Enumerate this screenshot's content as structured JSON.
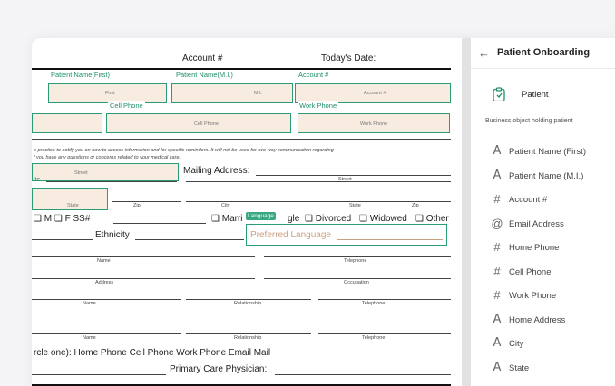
{
  "sidebar": {
    "back_icon": "arrow-left-icon",
    "title": "Patient Onboarding",
    "object_name": "Patient",
    "object_description": "Business object holding patient",
    "fields": [
      {
        "icon": "text-icon",
        "glyph": "A",
        "label": "Patient Name (First)"
      },
      {
        "icon": "text-icon",
        "glyph": "A",
        "label": "Patient Name (M.I.)"
      },
      {
        "icon": "number-icon",
        "glyph": "#",
        "label": "Account #"
      },
      {
        "icon": "email-icon",
        "glyph": "@",
        "label": "Email Address"
      },
      {
        "icon": "number-icon",
        "glyph": "#",
        "label": "Home Phone"
      },
      {
        "icon": "number-icon",
        "glyph": "#",
        "label": "Cell Phone"
      },
      {
        "icon": "number-icon",
        "glyph": "#",
        "label": "Work Phone"
      },
      {
        "icon": "text-icon",
        "glyph": "A",
        "label": "Home Address"
      },
      {
        "icon": "text-icon",
        "glyph": "A",
        "label": "City"
      },
      {
        "icon": "text-icon",
        "glyph": "A",
        "label": "State"
      }
    ]
  },
  "doc": {
    "account_label": "Account #",
    "today_label": "Today's Date:",
    "overlays": {
      "first_label": "Patient Name(First)",
      "first_inner": "First",
      "mi_label": "Patient Name(M.I.)",
      "mi_inner": "M.I.",
      "account_label": "Account #",
      "account_inner": "Account #",
      "cell_label": "Cell Phone",
      "cell_inner": "Cell Phone",
      "work_label": "Work Phone",
      "work_inner": "Work Phone",
      "street_label": "Street",
      "state_inner": "State",
      "language_tag": "Language",
      "language_text": "Preferred Language"
    },
    "consent_line1": "e practice to notify you on how to access information and for specific reminders. It will not be used for two-way communication regarding",
    "consent_line2": "f you have any questions or concerns related to your medical care.",
    "mailing_label": "Mailing Address:",
    "ite": "ite",
    "street_small": "Street",
    "street_small2": "Street",
    "zip_small": "Zip",
    "city_small": "City",
    "state_small": "State",
    "zip_small2": "Zip",
    "sex_line": "❏ M  ❏ F   SS#",
    "marri": "❏ Marri",
    "gle": "gle",
    "divorced": "❏ Divorced",
    "widowed": "❏ Widowed",
    "other": "❏ Other",
    "ethnicity": "Ethnicity",
    "name1": "Name",
    "telephone1": "Telephone",
    "address": "Address",
    "occupation": "Occupation",
    "name2": "Name",
    "relationship1": "Relationship",
    "telephone2": "Telephone",
    "name3": "Name",
    "relationship2": "Relationship",
    "telephone3": "Telephone",
    "circle_line": "rcle one): Home Phone   Cell Phone   Work Phone   Email Mail",
    "pcp": "Primary Care Physician:"
  }
}
